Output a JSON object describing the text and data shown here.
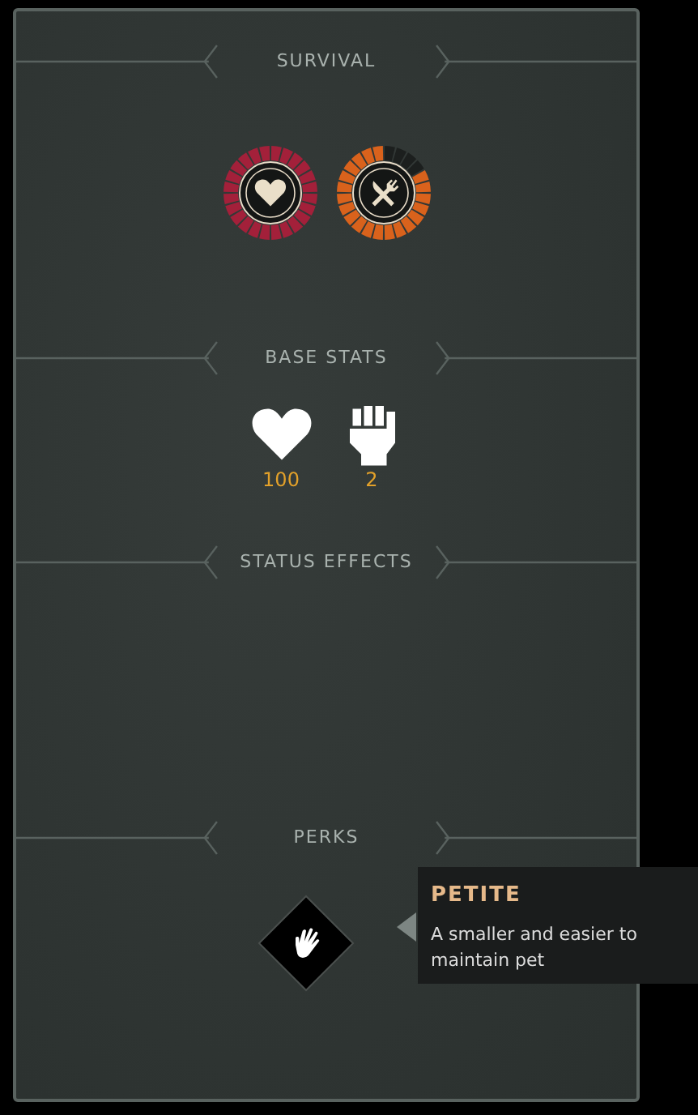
{
  "sections": [
    {
      "kind": "meters",
      "title": "SURVIVAL",
      "meters": [
        {
          "color": "#a3203a"
        },
        {
          "color": "#d9621c"
        }
      ]
    },
    {
      "kind": "stats",
      "title": "BASE STATS",
      "stats": [
        {
          "value": "100"
        },
        {
          "value": "2"
        }
      ]
    },
    {
      "kind": "effects",
      "title": "STATUS EFFECTS"
    },
    {
      "kind": "perks",
      "title": "PERKS",
      "perks": [
        {
          "selected": true
        }
      ]
    }
  ],
  "tooltip": {
    "title": "PETITE",
    "description": "A smaller and easier to maintain pet"
  }
}
